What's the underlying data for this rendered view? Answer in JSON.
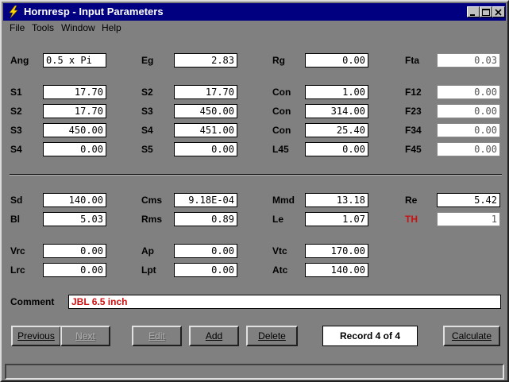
{
  "window": {
    "title": "Hornresp - Input Parameters"
  },
  "menu": [
    "File",
    "Tools",
    "Window",
    "Help"
  ],
  "fields": [
    {
      "id": "ang",
      "label": "Ang",
      "value": "0.5 x Pi",
      "align": "left"
    },
    {
      "id": "eg",
      "label": "Eg",
      "value": "2.83"
    },
    {
      "id": "rg",
      "label": "Rg",
      "value": "0.00"
    },
    {
      "id": "fta",
      "label": "Fta",
      "value": "0.03",
      "readonly": true
    },
    {
      "id": "s1",
      "label": "S1",
      "value": "17.70"
    },
    {
      "id": "s2b",
      "label": "S2",
      "value": "17.70"
    },
    {
      "id": "con1",
      "label": "Con",
      "value": "1.00"
    },
    {
      "id": "f12",
      "label": "F12",
      "value": "0.00",
      "readonly": true
    },
    {
      "id": "s2",
      "label": "S2",
      "value": "17.70"
    },
    {
      "id": "s3b",
      "label": "S3",
      "value": "450.00"
    },
    {
      "id": "con2",
      "label": "Con",
      "value": "314.00"
    },
    {
      "id": "f23",
      "label": "F23",
      "value": "0.00",
      "readonly": true
    },
    {
      "id": "s3",
      "label": "S3",
      "value": "450.00"
    },
    {
      "id": "s4b",
      "label": "S4",
      "value": "451.00"
    },
    {
      "id": "con3",
      "label": "Con",
      "value": "25.40"
    },
    {
      "id": "f34",
      "label": "F34",
      "value": "0.00",
      "readonly": true
    },
    {
      "id": "s4",
      "label": "S4",
      "value": "0.00"
    },
    {
      "id": "s5",
      "label": "S5",
      "value": "0.00"
    },
    {
      "id": "l45",
      "label": "L45",
      "value": "0.00"
    },
    {
      "id": "f45",
      "label": "F45",
      "value": "0.00",
      "readonly": true
    },
    {
      "id": "sd",
      "label": "Sd",
      "value": "140.00"
    },
    {
      "id": "cms",
      "label": "Cms",
      "value": "9.18E-04"
    },
    {
      "id": "mmd",
      "label": "Mmd",
      "value": "13.18"
    },
    {
      "id": "re",
      "label": "Re",
      "value": "5.42"
    },
    {
      "id": "bl",
      "label": "Bl",
      "value": "5.03"
    },
    {
      "id": "rms",
      "label": "Rms",
      "value": "0.89"
    },
    {
      "id": "le",
      "label": "Le",
      "value": "1.07"
    },
    {
      "id": "th",
      "label": "TH",
      "value": "1",
      "readonly": true,
      "label_color": "#cc1111"
    },
    {
      "id": "vrc",
      "label": "Vrc",
      "value": "0.00"
    },
    {
      "id": "ap",
      "label": "Ap",
      "value": "0.00"
    },
    {
      "id": "vtc",
      "label": "Vtc",
      "value": "170.00"
    },
    {
      "id": "lrc",
      "label": "Lrc",
      "value": "0.00"
    },
    {
      "id": "lpt",
      "label": "Lpt",
      "value": "0.00"
    },
    {
      "id": "atc",
      "label": "Atc",
      "value": "140.00"
    }
  ],
  "comment": {
    "label": "Comment",
    "value": "JBL 6.5 inch"
  },
  "buttons": [
    {
      "id": "previous",
      "label": "Previous",
      "enabled": true
    },
    {
      "id": "next",
      "label": "Next",
      "enabled": false
    },
    {
      "id": "edit",
      "label": "Edit",
      "enabled": false
    },
    {
      "id": "add",
      "label": "Add",
      "enabled": true
    },
    {
      "id": "delete",
      "label": "Delete",
      "enabled": true
    },
    {
      "id": "calculate",
      "label": "Calculate",
      "enabled": true
    }
  ],
  "record": "Record 4 of 4",
  "colors": {
    "accent_red": "#cc1111",
    "titlebar": "#000080",
    "window_bg": "#808080"
  }
}
